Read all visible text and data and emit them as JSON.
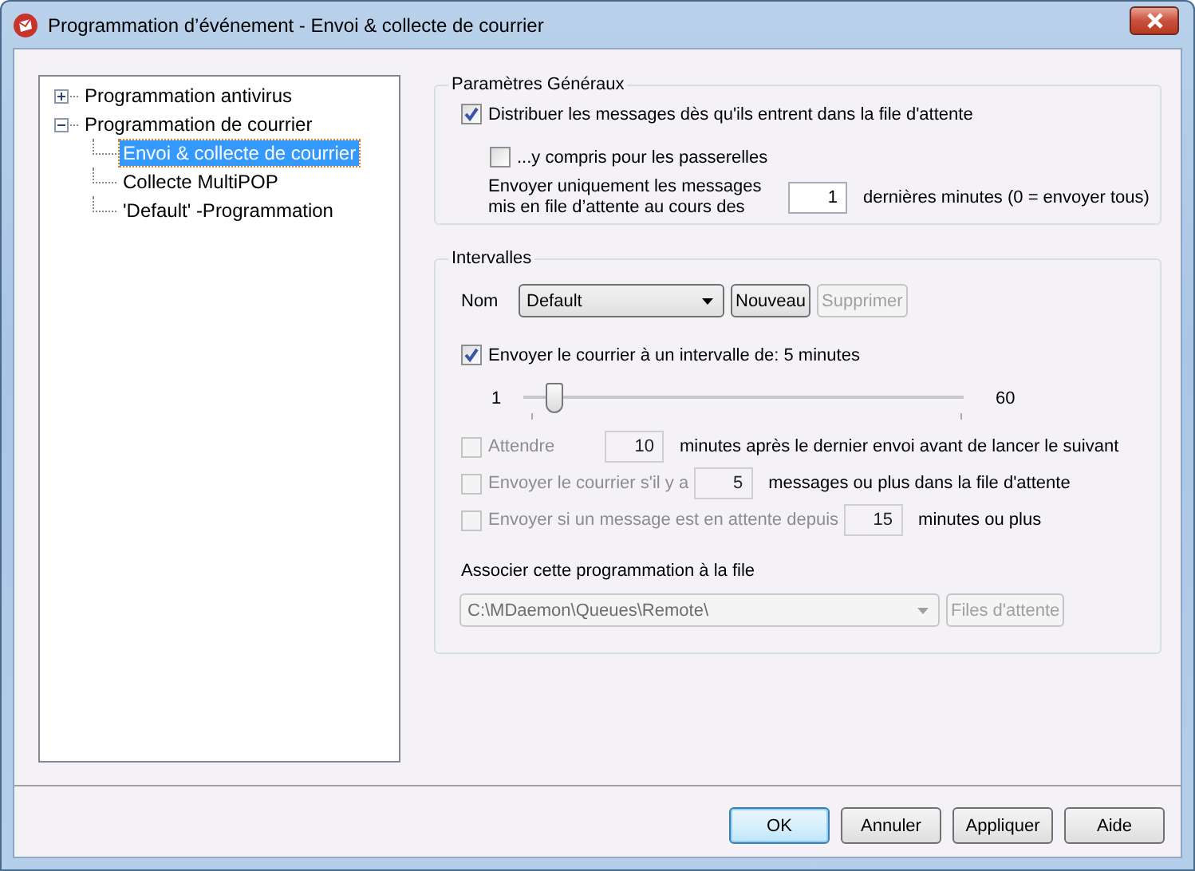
{
  "window": {
    "title": "Programmation d’événement - Envoi & collecte de courrier"
  },
  "tree": [
    {
      "label": "Programmation antivirus",
      "expanded": false,
      "selected": false
    },
    {
      "label": "Programmation de courrier",
      "expanded": true,
      "selected": false,
      "children": [
        {
          "label": "Envoi & collecte de courrier",
          "selected": true
        },
        {
          "label": "Collecte MultiPOP",
          "selected": false
        },
        {
          "label": "'Default' -Programmation",
          "selected": false
        }
      ]
    }
  ],
  "general": {
    "title": "Paramètres Généraux",
    "deliver": {
      "label": "Distribuer les messages dès qu'ils entrent dans la file d'attente",
      "checked": true
    },
    "gateways": {
      "label": "...y compris pour les passerelles",
      "checked": false
    },
    "only_recent": {
      "label": "Envoyer uniquement les messages mis en file d’attente au cours des",
      "value": "1",
      "suffix": "dernières minutes (0 = envoyer tous)"
    }
  },
  "intervals": {
    "title": "Intervalles",
    "name_label": "Nom",
    "name_value": "Default",
    "new_button": {
      "label": "Nouveau",
      "disabled": false
    },
    "delete_button": {
      "label": "Supprimer",
      "disabled": true
    },
    "interval_check": {
      "label": "Envoyer le courrier à un intervalle de: 5 minutes",
      "checked": true
    },
    "slider": {
      "min_label": "1",
      "max_label": "60",
      "level": 0.07
    },
    "conditions": [
      {
        "label": "Attendre",
        "value": "10",
        "suffix": "minutes après le dernier envoi avant de lancer le suivant",
        "checked": false,
        "disabled": true
      },
      {
        "label": "Envoyer le courrier s'il y a",
        "value": "5",
        "suffix": "messages ou plus dans la file d'attente",
        "checked": false,
        "disabled": true
      },
      {
        "label": "Envoyer si un message est en attente depuis",
        "value": "15",
        "suffix": "minutes ou plus",
        "checked": false,
        "disabled": true
      }
    ],
    "queue_label": "Associer cette programmation à la file",
    "queue_value": "C:\\MDaemon\\Queues\\Remote\\",
    "queue_disabled": true,
    "queues_button": {
      "label": "Files d'attente",
      "disabled": true
    }
  },
  "buttons": [
    {
      "label": "OK",
      "default": true
    },
    {
      "label": "Annuler",
      "default": false
    },
    {
      "label": "Appliquer",
      "default": false
    },
    {
      "label": "Aide",
      "default": false
    }
  ]
}
